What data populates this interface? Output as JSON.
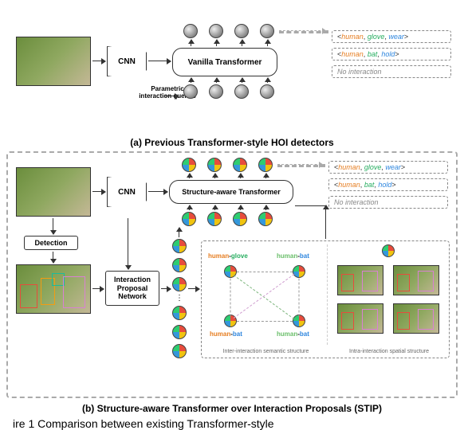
{
  "section_a": {
    "caption": "(a) Previous Transformer-style HOI detectors",
    "cnn": "CNN",
    "transformer": "Vanilla Transformer",
    "param_label_l1": "Parametric",
    "param_label_l2": "interaction queries",
    "outputs": [
      {
        "prefix": "<",
        "human": "human",
        "sep1": ", ",
        "obj": "glove",
        "sep2": ", ",
        "verb": "wear",
        "suffix": ">"
      },
      {
        "prefix": "<",
        "human": "human",
        "sep1": ", ",
        "obj": "bat",
        "sep2": ", ",
        "verb": "hold",
        "suffix": ">"
      },
      {
        "none": "No interaction"
      }
    ]
  },
  "section_b": {
    "caption": "(b) Structure-aware Transformer over Interaction Proposals (STIP)",
    "cnn": "CNN",
    "transformer": "Structure-aware Transformer",
    "detection": "Detection",
    "ipn_l1": "Interaction",
    "ipn_l2": "Proposal",
    "ipn_l3": "Network",
    "outputs": [
      {
        "prefix": "<",
        "human": "human",
        "sep1": ", ",
        "obj": "glove",
        "sep2": ", ",
        "verb": "wear",
        "suffix": ">"
      },
      {
        "prefix": "<",
        "human": "human",
        "sep1": ", ",
        "obj": "bat",
        "sep2": ", ",
        "verb": "hold",
        "suffix": ">"
      },
      {
        "none": "No interaction"
      }
    ],
    "semantic": {
      "nodes": [
        "human-glove",
        "human-bat",
        "human-bat",
        "human-bat"
      ],
      "caption": "Inter-interaction semantic structure"
    },
    "spatial": {
      "caption": "Intra-interaction spatial structure"
    }
  },
  "bottom_caption_prefix": "ire 1   Comparison between existing Transformer-style"
}
